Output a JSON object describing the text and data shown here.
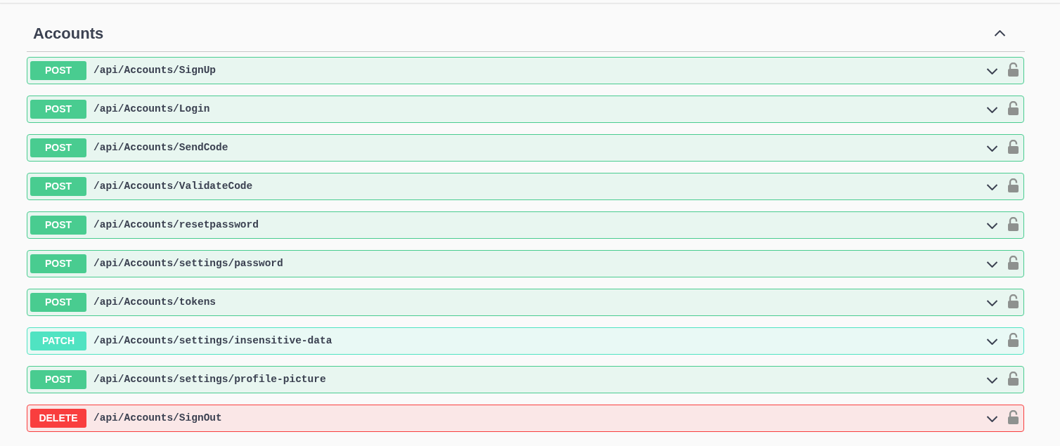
{
  "section": {
    "title": "Accounts",
    "expanded": true,
    "operations": [
      {
        "kind": "post",
        "method": "POST",
        "path": "/api/Accounts/SignUp",
        "expanded": false
      },
      {
        "kind": "post",
        "method": "POST",
        "path": "/api/Accounts/Login",
        "expanded": false
      },
      {
        "kind": "post",
        "method": "POST",
        "path": "/api/Accounts/SendCode",
        "expanded": false
      },
      {
        "kind": "post",
        "method": "POST",
        "path": "/api/Accounts/ValidateCode",
        "expanded": false
      },
      {
        "kind": "post",
        "method": "POST",
        "path": "/api/Accounts/resetpassword",
        "expanded": false
      },
      {
        "kind": "post",
        "method": "POST",
        "path": "/api/Accounts/settings/password",
        "expanded": false
      },
      {
        "kind": "post",
        "method": "POST",
        "path": "/api/Accounts/tokens",
        "expanded": false
      },
      {
        "kind": "patch",
        "method": "PATCH",
        "path": "/api/Accounts/settings/insensitive-data",
        "expanded": false
      },
      {
        "kind": "post",
        "method": "POST",
        "path": "/api/Accounts/settings/profile-picture",
        "expanded": false
      },
      {
        "kind": "delete",
        "method": "DELETE",
        "path": "/api/Accounts/SignOut",
        "expanded": false
      }
    ]
  }
}
